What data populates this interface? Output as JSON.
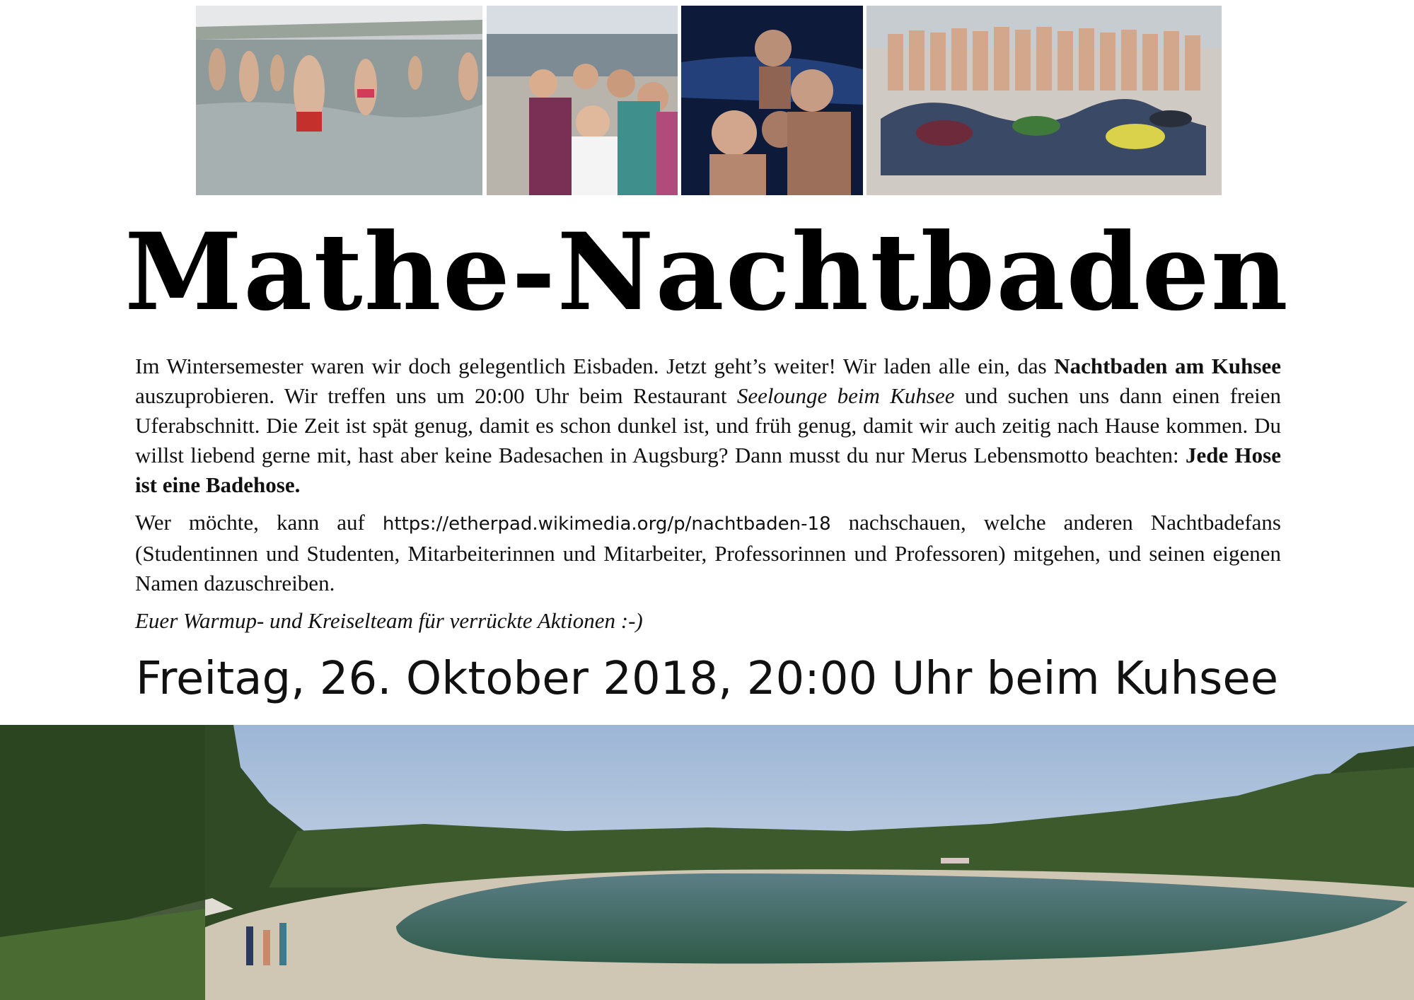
{
  "title": "Mathe-Nachtbaden",
  "paragraph1": {
    "t1": "Im Wintersemester waren wir doch gelegentlich Eisbaden. Jetzt geht’s weiter! Wir laden alle ein, das ",
    "b1": "Nachtbaden am Kuhsee",
    "t2": " auszuprobieren. Wir treffen uns um ",
    "time": "20:00",
    "t3": " Uhr beim Restaurant ",
    "i1": "Seelounge beim Kuhsee",
    "t4": " und suchen uns dann einen freien Uferabschnitt. Die Zeit ist spät genug, damit es schon dunkel ist, und früh genug, damit wir auch zeitig nach Hause kommen. Du willst liebend gerne mit, hast aber keine Badesachen in Augsburg? Dann musst du nur Merus Lebensmotto beachten: ",
    "b2": "Jede Hose ist eine Badehose."
  },
  "paragraph2": {
    "t1": "Wer möchte, kann auf ",
    "url": "https://etherpad.wikimedia.org/p/nachtbaden-18",
    "t2": " nachschauen, welche anderen Nacht­badefans (Studentinnen und Studenten, Mitarbeiterinnen und Mitarbeiter, Professorinnen und Professoren) mitgehen, und seinen eigenen Namen dazuschreiben."
  },
  "signature": "Euer Warmup- und Kreiselteam für verrückte Aktionen :-)",
  "event_line": "Freitag, 26. Oktober 2018, 20:00 Uhr beim Kuhsee",
  "colors": {
    "text": "#111111",
    "lake": "#3f6b5c",
    "sky": "#b9cbe0",
    "forest": "#2f4a25"
  }
}
